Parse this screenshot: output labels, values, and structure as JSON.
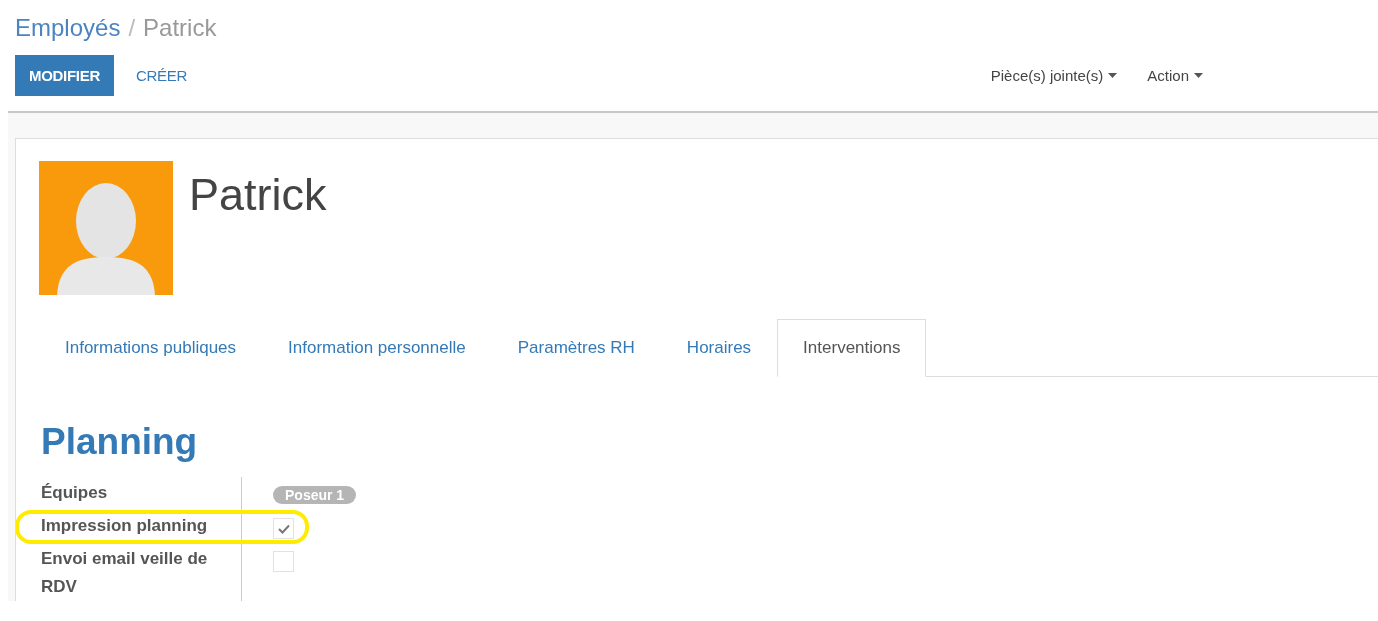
{
  "breadcrumb": [
    {
      "label": "Employés",
      "selected": false
    },
    {
      "label": "Patrick",
      "selected": true
    }
  ],
  "breadcrumb_separator": "/",
  "buttons": [
    {
      "label": "MODIFIER",
      "kind": "primary"
    },
    {
      "label": "CRÉER",
      "kind": "link"
    }
  ],
  "menus": [
    {
      "label": "Pièce(s) jointe(s)"
    },
    {
      "label": "Action"
    }
  ],
  "employee": {
    "name": "Patrick"
  },
  "tabs": [
    {
      "label": "Informations publiques",
      "selected": false
    },
    {
      "label": "Information personnelle",
      "selected": false
    },
    {
      "label": "Paramètres RH",
      "selected": false
    },
    {
      "label": "Horaires",
      "selected": false
    },
    {
      "label": "Interventions",
      "selected": true
    }
  ],
  "section": {
    "title": "Planning"
  },
  "fields": [
    {
      "label": "Équipes",
      "kind": "tags",
      "tags": [
        "Poseur 1"
      ],
      "highlighted": false
    },
    {
      "label": "Impression planning",
      "kind": "checkbox",
      "checked": true,
      "highlighted": true
    },
    {
      "label": "Envoi email veille de RDV",
      "kind": "checkbox",
      "checked": false,
      "highlighted": false
    }
  ]
}
